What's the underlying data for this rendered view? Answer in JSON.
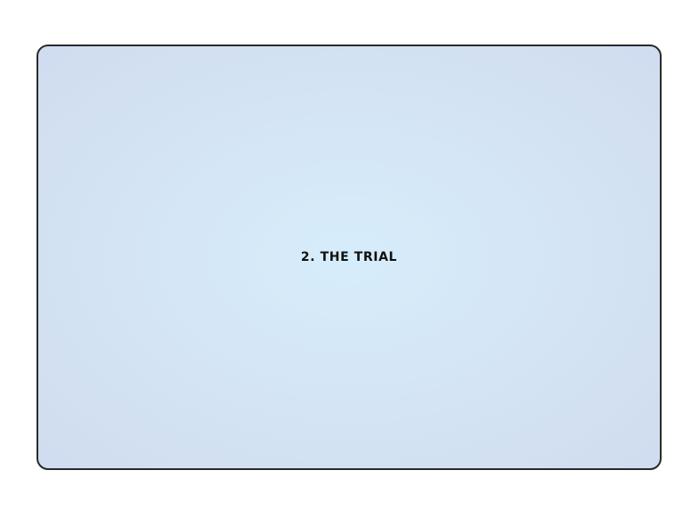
{
  "slide": {
    "title": "2. THE TRIAL"
  }
}
